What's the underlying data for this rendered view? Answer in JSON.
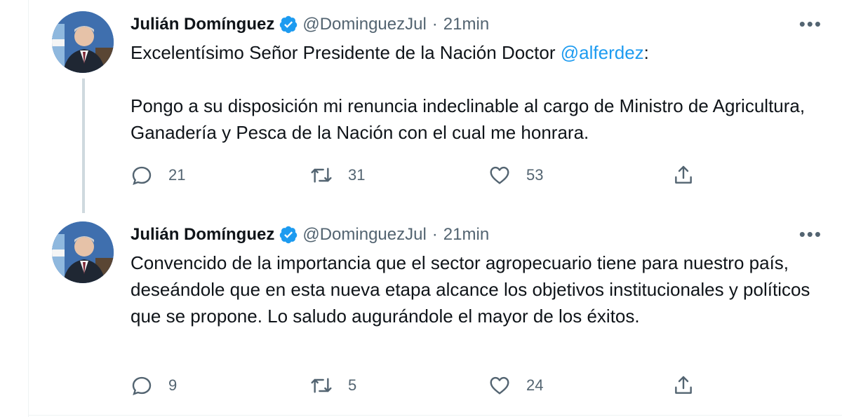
{
  "tweets": [
    {
      "author_name": "Julián Domínguez",
      "handle": "@DominguezJul",
      "separator": "·",
      "time": "21min",
      "more_label": "•••",
      "paragraphs": [
        {
          "text": "Excelentísimo Señor Presidente de la Nación Doctor ",
          "mention": "@alferdez",
          "after": ":"
        },
        {
          "text": "Pongo a su disposición mi renuncia indeclinable al cargo de Ministro de Agricultura, Ganadería y Pesca de la Nación con el cual me honrara.",
          "mention": "",
          "after": ""
        }
      ],
      "replies": "21",
      "retweets": "31",
      "likes": "53"
    },
    {
      "author_name": "Julián Domínguez",
      "handle": "@DominguezJul",
      "separator": "·",
      "time": "21min",
      "more_label": "•••",
      "paragraphs": [
        {
          "text": "Convencido de la importancia que el sector agropecuario tiene para nuestro país, deseándole que en esta nueva etapa alcance los objetivos institucionales y políticos que se propone. Lo saludo augurándole el mayor de los éxitos.",
          "mention": "",
          "after": ""
        }
      ],
      "replies": "9",
      "retweets": "5",
      "likes": "24"
    }
  ],
  "colors": {
    "accent": "#1d9bf0",
    "text": "#0f1419",
    "secondary": "#536471",
    "thread_line": "#cfd9de"
  },
  "icons": [
    "verified-badge-icon",
    "more-icon",
    "reply-icon",
    "retweet-icon",
    "like-icon",
    "share-icon"
  ]
}
